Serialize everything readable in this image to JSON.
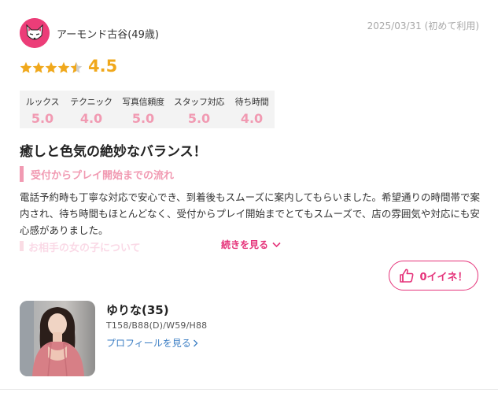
{
  "reviewer": {
    "name": "アーモンド古谷(49歳)",
    "icon": "fox-mask-icon"
  },
  "review_date": "2025/03/31 (初めて利用)",
  "rating": {
    "value": 4.5,
    "label": "4.5",
    "stars": 4.5
  },
  "scores": [
    {
      "label": "ルックス",
      "value": "5.0"
    },
    {
      "label": "テクニック",
      "value": "4.0"
    },
    {
      "label": "写真信頼度",
      "value": "5.0"
    },
    {
      "label": "スタッフ対応",
      "value": "5.0"
    },
    {
      "label": "待ち時間",
      "value": "4.0"
    }
  ],
  "review_title": "癒しと色気の絶妙なバランス！",
  "section_title": "受付からプレイ開始までの流れ",
  "body_text": "電話予約時も丁寧な対応で安心でき、到着後もスムーズに案内してもらいました。希望通りの時間帯で案内され、待ち時間もほとんどなく、受付からプレイ開始までとてもスムーズで、店の雰囲気や対応にも安心感がありました。",
  "faded_next_section": "お相手の女の子について",
  "read_more": "続きを見る",
  "like_label": "0イイネ！",
  "cast": {
    "name": "ゆりな(35)",
    "stats": "T158/B88(D)/W59/H88",
    "profile_link": "プロフィールを見る"
  },
  "colors": {
    "pink": "#f19ab2",
    "accent": "#e5337a",
    "gold": "#f0a81c",
    "link": "#3d7fc4"
  }
}
